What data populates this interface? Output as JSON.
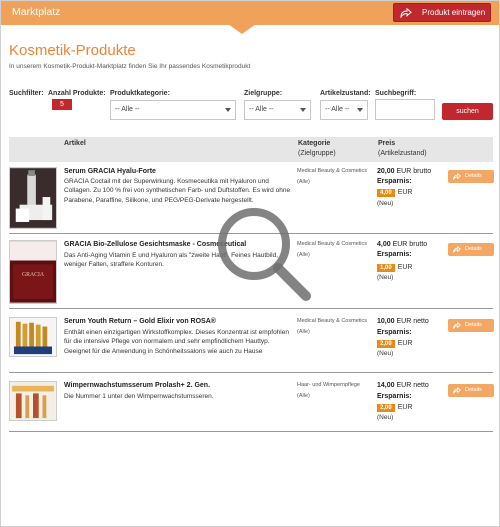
{
  "topbar": {
    "title": "Marktplatz",
    "button_label": "Produkt eintragen"
  },
  "page": {
    "title": "Kosmetik-Produkte",
    "subtitle": "In unserem Kosmetik-Produkt-Marktplatz finden Sie Ihr passendes Kosmetikprodukt"
  },
  "filters": {
    "label": "Suchfilter:",
    "count_label": "Anzahl Produkte:",
    "count": "5",
    "category_label": "Produktkategorie:",
    "category_value": "-- Alle --",
    "target_label": "Zielgruppe:",
    "target_value": "-- Alle --",
    "condition_label": "Artikelzustand:",
    "condition_value": "-- Alle --",
    "search_label": "Suchbegriff:",
    "search_value": "",
    "search_button": "suchen"
  },
  "table": {
    "col_article": "Artikel",
    "col_category": "Kategorie",
    "col_category_sub": "(Zielgruppe)",
    "col_price": "Preis",
    "col_price_sub": "(Artikelzustand)"
  },
  "products": [
    {
      "title": "Serum GRACIA Hyalu-Forte",
      "desc": "GRACIA Coctail mit der Superwirkung. Kosmeceutika mit Hyaluron und Collagen. Zu 100 % frei von synthetischen Farb- und Duftstoffen. Es wird ohne Parabene, Paraffine, Silikone, und PEG/PEG-Derivate hergestellt.",
      "category": "Medical Beauty & Cosmetics",
      "target": "(Alle)",
      "price": "20,00",
      "price_suffix": "EUR brutto",
      "savings_label": "Ersparnis:",
      "savings": "4,00",
      "savings_unit": "EUR",
      "condition": "(Neu)",
      "button": "Details"
    },
    {
      "title": "GRACIA Bio-Zellulose Gesichtsmaske - Cosmeceutical",
      "desc": "Das Anti-Aging Vitamin E und Hyaluron als \"zweite Haut\". Feines Hautbild, weniger Falten, straffere Konturen.",
      "category": "Medical Beauty & Cosmetics",
      "target": "(Alle)",
      "price": "4,00",
      "price_suffix": "EUR brutto",
      "savings_label": "Ersparnis:",
      "savings": "1,00",
      "savings_unit": "EUR",
      "condition": "(Neu)",
      "button": "Details",
      "image_text": "GRACIA"
    },
    {
      "title": "Serum Youth Return – Gold Elixir von ROSA®",
      "desc": "Enthält einen einzigartigen Wirkstoffkomplex. Dieses Konzentrat ist empfohlen für die intensive Pflege von normalem und sehr empfindlichem Hauttyp. Geeignet für die Anwendung in Schönheitssalons wie auch zu Hause",
      "category": "Medical Beauty & Cosmetics",
      "target": "(Alle)",
      "price": "10,00",
      "price_suffix": "EUR netto",
      "savings_label": "Ersparnis:",
      "savings": "2,00",
      "savings_unit": "EUR",
      "condition": "(Neu)",
      "button": "Details"
    },
    {
      "title": "Wimpernwachstumsserum Prolash+ 2. Gen.",
      "desc": "Die Nummer 1 unter den Wimpernwachstumsseren.",
      "category": "Haar- und Wimpernpflege",
      "target": "(Alle)",
      "price": "14,00",
      "price_suffix": "EUR netto",
      "savings_label": "Ersparnis:",
      "savings": "2,00",
      "savings_unit": "EUR",
      "condition": "(Neu)",
      "button": "Details"
    }
  ],
  "colors": {
    "accent_orange": "#f0a25a",
    "title_orange": "#e8863a",
    "brand_red": "#c0282d",
    "savings_badge": "#e88a14"
  }
}
